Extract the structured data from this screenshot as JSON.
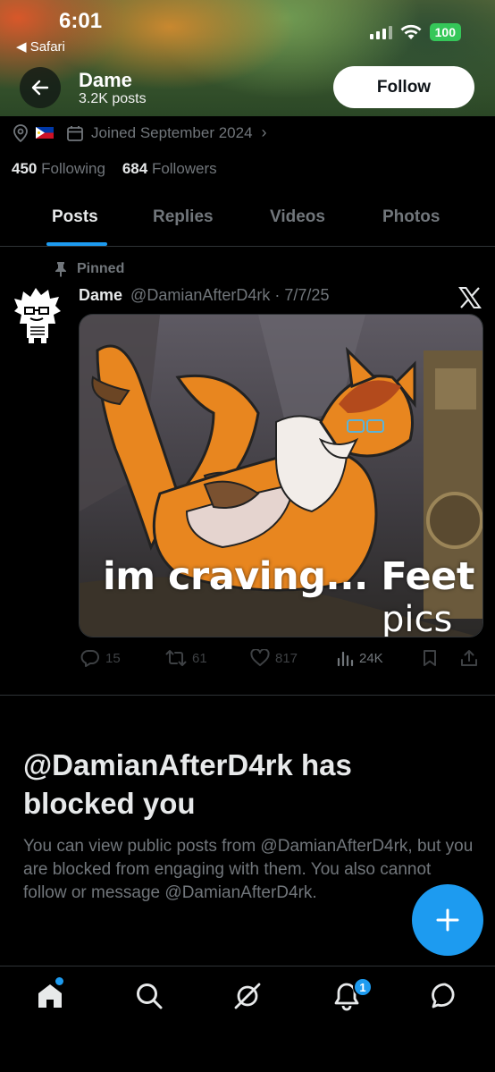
{
  "status_bar": {
    "time": "6:01",
    "back_app": "◀ Safari",
    "battery": "100"
  },
  "header": {
    "name": "Dame",
    "posts_count": "3.2K posts",
    "follow_label": "Follow"
  },
  "profile": {
    "joined": "Joined September 2024",
    "following_count": "450",
    "following_label": "Following",
    "followers_count": "684",
    "followers_label": "Followers"
  },
  "tabs": [
    {
      "label": "Posts",
      "active": true
    },
    {
      "label": "Replies",
      "active": false
    },
    {
      "label": "Videos",
      "active": false
    },
    {
      "label": "Photos",
      "active": false
    }
  ],
  "pinned_post": {
    "pinned_label": "Pinned",
    "author_name": "Dame",
    "author_handle": "@DamianAfterD4rk",
    "separator": "·",
    "date": "7/7/25",
    "media_caption_line1": "im craving... Feet",
    "media_caption_line2": "pics",
    "replies": "15",
    "reposts": "61",
    "likes": "817",
    "views": "24K"
  },
  "blocked": {
    "title": "@DamianAfterD4rk has blocked you",
    "body": "You can view public posts from @DamianAfterD4rk, but you are blocked from engaging with them. You also cannot follow or message @DamianAfterD4rk."
  },
  "bottom_nav": {
    "notifications_badge": "1"
  },
  "colors": {
    "accent": "#1d9bf0",
    "background": "#000000",
    "muted_text": "#71767b"
  },
  "icons": [
    "back-arrow-icon",
    "location-icon",
    "philippines-flag-icon",
    "calendar-icon",
    "pin-icon",
    "x-logo-icon",
    "reply-icon",
    "repost-icon",
    "like-icon",
    "views-icon",
    "bookmark-icon",
    "share-icon",
    "compose-plus-icon",
    "home-icon",
    "search-icon",
    "grok-icon",
    "bell-icon",
    "messages-icon"
  ]
}
